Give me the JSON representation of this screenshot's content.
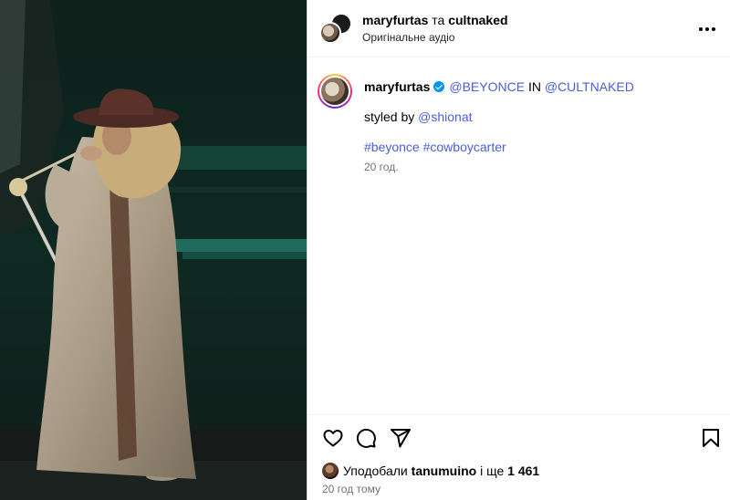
{
  "post": {
    "media": {
      "alt_icon": "video-frame"
    },
    "header": {
      "author": "maryfurtas",
      "connector": "та",
      "coauthor": "cultnaked",
      "audio": "Оригінальне аудіо"
    },
    "caption": {
      "username": "maryfurtas",
      "mention_1": "@BEYONCE",
      "in_word": "IN",
      "mention_2": "@CULTNAKED",
      "styled_by": "styled by",
      "stylist": "@shionat",
      "hashtag_1": "#beyonce",
      "hashtag_2": "#cowboycarter",
      "time": "20 год."
    },
    "actions": {
      "like_icon": "heart-icon",
      "comment_icon": "comment-icon",
      "share_icon": "share-icon",
      "save_icon": "bookmark-icon"
    },
    "likes": {
      "prefix": "Уподобали",
      "user": "tanumuino",
      "middle": "і ще",
      "count": "1 461"
    },
    "post_time": "20 год тому"
  },
  "colors": {
    "link": "#4b5ed6",
    "verified": "#0095f6",
    "muted": "#737373"
  }
}
